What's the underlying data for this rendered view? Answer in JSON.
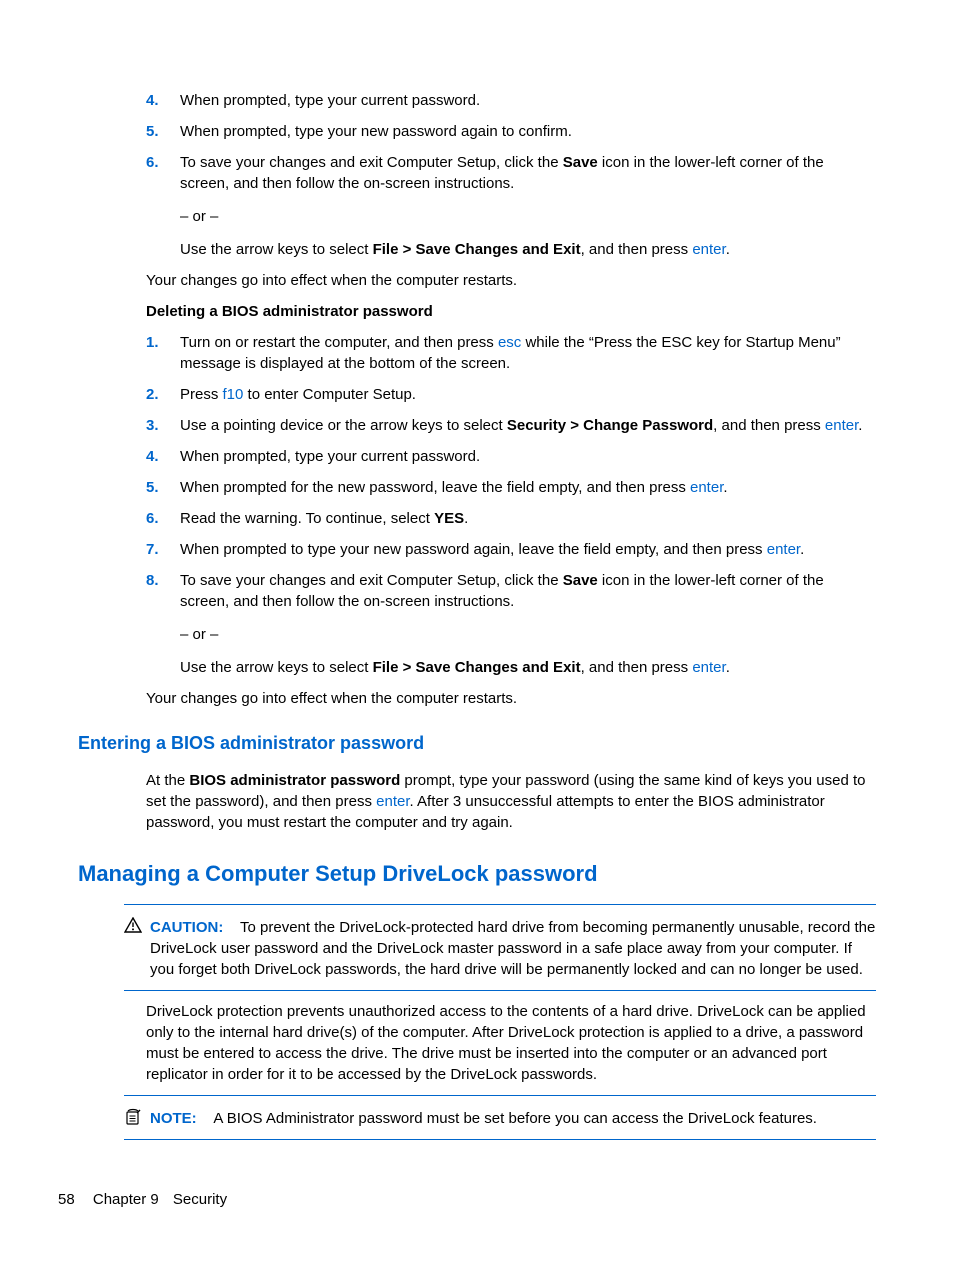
{
  "steps_top": [
    {
      "n": "4.",
      "html": [
        {
          "t": "When prompted, type your current password."
        }
      ]
    },
    {
      "n": "5.",
      "html": [
        {
          "t": "When prompted, type your new password again to confirm."
        }
      ]
    },
    {
      "n": "6.",
      "html": [
        {
          "t": "To save your changes and exit Computer Setup, click the "
        },
        {
          "t": "Save",
          "b": true
        },
        {
          "t": " icon in the lower-left corner of the screen, and then follow the on-screen instructions."
        }
      ],
      "subs": [
        {
          "html": [
            {
              "t": "– or –"
            }
          ]
        },
        {
          "html": [
            {
              "t": "Use the arrow keys to select "
            },
            {
              "t": "File > Save Changes and Exit",
              "b": true
            },
            {
              "t": ", and then press "
            },
            {
              "t": "enter",
              "k": true
            },
            {
              "t": "."
            }
          ]
        }
      ]
    }
  ],
  "after_top": "Your changes go into effect when the computer restarts.",
  "del_heading": "Deleting a BIOS administrator password",
  "steps_del": [
    {
      "n": "1.",
      "html": [
        {
          "t": "Turn on or restart the computer, and then press "
        },
        {
          "t": "esc",
          "k": true
        },
        {
          "t": " while the “Press the ESC key for Startup Menu” message is displayed at the bottom of the screen."
        }
      ]
    },
    {
      "n": "2.",
      "html": [
        {
          "t": "Press "
        },
        {
          "t": "f10",
          "k": true
        },
        {
          "t": " to enter Computer Setup."
        }
      ]
    },
    {
      "n": "3.",
      "html": [
        {
          "t": "Use a pointing device or the arrow keys to select "
        },
        {
          "t": "Security > Change Password",
          "b": true
        },
        {
          "t": ", and then press "
        },
        {
          "t": "enter",
          "k": true
        },
        {
          "t": "."
        }
      ]
    },
    {
      "n": "4.",
      "html": [
        {
          "t": "When prompted, type your current password."
        }
      ]
    },
    {
      "n": "5.",
      "html": [
        {
          "t": "When prompted for the new password, leave the field empty, and then press "
        },
        {
          "t": "enter",
          "k": true
        },
        {
          "t": "."
        }
      ]
    },
    {
      "n": "6.",
      "html": [
        {
          "t": "Read the warning. To continue, select "
        },
        {
          "t": "YES",
          "b": true
        },
        {
          "t": "."
        }
      ]
    },
    {
      "n": "7.",
      "html": [
        {
          "t": "When prompted to type your new password again, leave the field empty, and then press "
        },
        {
          "t": "enter",
          "k": true
        },
        {
          "t": "."
        }
      ]
    },
    {
      "n": "8.",
      "html": [
        {
          "t": "To save your changes and exit Computer Setup, click the "
        },
        {
          "t": "Save",
          "b": true
        },
        {
          "t": " icon in the lower-left corner of the screen, and then follow the on-screen instructions."
        }
      ],
      "subs": [
        {
          "html": [
            {
              "t": "– or –"
            }
          ]
        },
        {
          "html": [
            {
              "t": "Use the arrow keys to select "
            },
            {
              "t": "File > Save Changes and Exit",
              "b": true
            },
            {
              "t": ", and then press "
            },
            {
              "t": "enter",
              "k": true
            },
            {
              "t": "."
            }
          ]
        }
      ]
    }
  ],
  "after_del": "Your changes go into effect when the computer restarts.",
  "h3_enter": "Entering a BIOS administrator password",
  "enter_para": [
    {
      "t": "At the "
    },
    {
      "t": "BIOS administrator password",
      "b": true
    },
    {
      "t": " prompt, type your password (using the same kind of keys you used to set the password), and then press "
    },
    {
      "t": "enter",
      "k": true
    },
    {
      "t": ". After 3 unsuccessful attempts to enter the BIOS administrator password, you must restart the computer and try again."
    }
  ],
  "h2_manage": "Managing a Computer Setup DriveLock password",
  "caution_label": "CAUTION:",
  "caution_body": "To prevent the DriveLock-protected hard drive from becoming permanently unusable, record the DriveLock user password and the DriveLock master password in a safe place away from your computer. If you forget both DriveLock passwords, the hard drive will be permanently locked and can no longer be used.",
  "drivelock_para": "DriveLock protection prevents unauthorized access to the contents of a hard drive. DriveLock can be applied only to the internal hard drive(s) of the computer. After DriveLock protection is applied to a drive, a password must be entered to access the drive. The drive must be inserted into the computer or an advanced port replicator in order for it to be accessed by the DriveLock passwords.",
  "note_label": "NOTE:",
  "note_body": "A BIOS Administrator password must be set before you can access the DriveLock features.",
  "footer": {
    "page": "58",
    "chapter": "Chapter 9",
    "title": "Security"
  }
}
